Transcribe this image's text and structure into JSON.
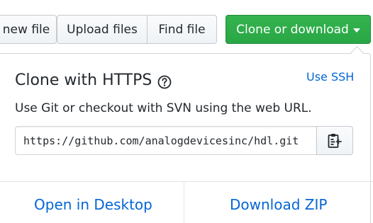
{
  "toolbar": {
    "new_file_label": "new file",
    "upload_files_label": "Upload files",
    "find_file_label": "Find file",
    "clone_label": "Clone or download"
  },
  "clone_panel": {
    "title": "Clone with HTTPS",
    "use_ssh_label": "Use SSH",
    "description": "Use Git or checkout with SVN using the web URL.",
    "url_value": "https://github.com/analogdevicesinc/hdl.git",
    "open_desktop_label": "Open in Desktop",
    "download_zip_label": "Download ZIP"
  },
  "colors": {
    "primary_green": "#28a745",
    "link_blue": "#0366d6",
    "border_gray": "#d1d5da"
  },
  "icons": {
    "help": "question-circle-icon",
    "copy": "clipboard-icon",
    "dropdown": "caret-down-icon"
  }
}
